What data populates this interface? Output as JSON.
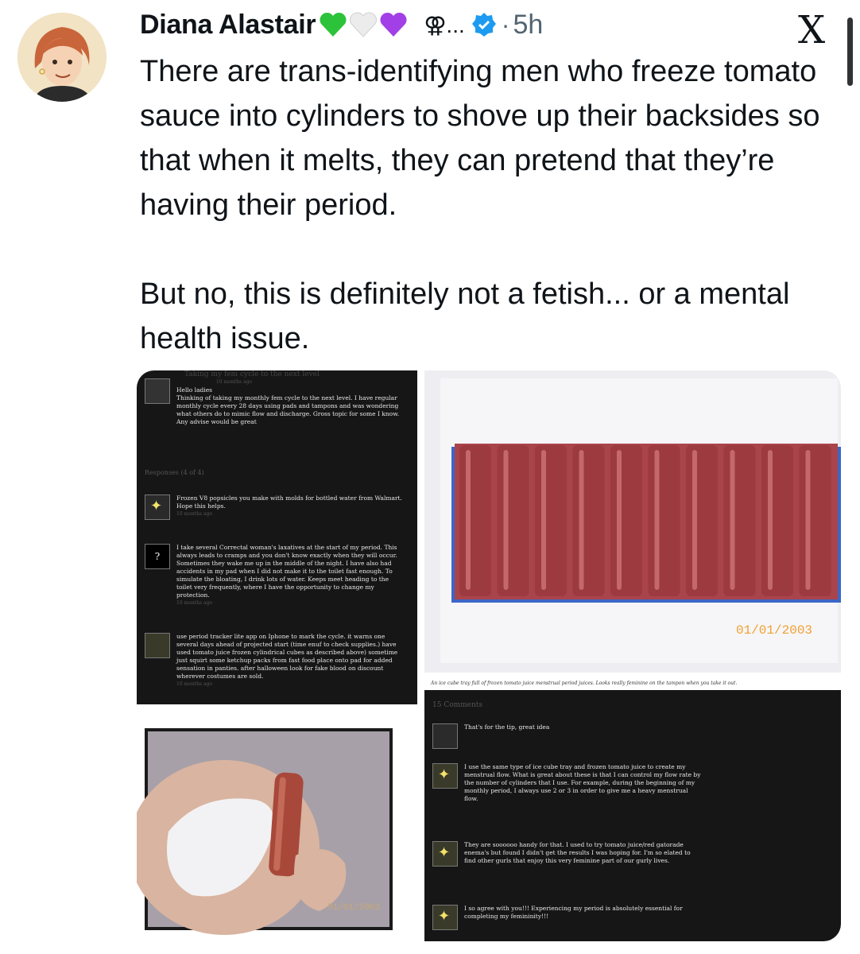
{
  "tweet": {
    "author": "Diana Alastair",
    "emoji_suffix": "⚢...",
    "time": "5h",
    "separator": "·",
    "x_logo": "X",
    "text": "There are trans-identifying men who freeze tomato sauce into cylinders to shove up their backsides so that when it melts, they can pretend that they’re having their period.\n\nBut no, this is definitely not a fetish... or a mental health issue.",
    "icons": [
      "avatar",
      "green-heart-icon",
      "white-heart-icon",
      "purple-heart-icon",
      "verified-badge-icon",
      "x-logo-icon"
    ],
    "colors": {
      "green_heart": "#2cc33a",
      "white_heart": "#e8e8e8",
      "purple_heart": "#a23fe6",
      "verified": "#1d9bf0"
    }
  },
  "forum_left": {
    "title": "Taking my fem cycle to the next level",
    "op_meta": "10 months ago",
    "op_text": "Hello ladies\nThinking of taking my monthly fem cycle to the next level. I have regular monthly cycle every 28 days using pads and tampons and was wondering what others do to mimic flow and discharge. Gross topic for some I know.\nAny advise would be great",
    "responses_label": "Responses (4 of 4)",
    "replies": [
      {
        "text": "Frozen V8 popsicles you make with molds for bottled water from Walmart. Hope this helps.",
        "meta": "10 months ago"
      },
      {
        "text": "I take several Correctal woman's laxatives at the start of my period. This always leads to cramps and you don't know exactly when they will occur. Sometimes they wake me up in the middle of the night. I have also had accidents in my pad when I did not make it to the toilet fast enough. To simulate the bloating, I drink lots of water. Keeps meet heading to the toilet very frequently, where I have the opportunity to change my protection.",
        "meta": "10 months ago"
      },
      {
        "text": "use period tracker lite app on Iphone to mark the cycle. it warns one several days ahead of projected start (time enuf to check supplies.) have used tomato juice frozen cylindrical cubes as described above) sometime just squirt some ketchup packs from fast food place onto pad for added sensation in panties. after halloween look for fake blood on discount wherever costumes are sold.",
        "meta": "10 months ago"
      }
    ]
  },
  "photo_small": {
    "date_stamp": "01/01/2003"
  },
  "photo_tray": {
    "date_stamp": "01/01/2003",
    "caption": "An ice cube tray full of frozen tomato juice menstrual period juices. Looks really feminine on the tampon when you take it out.",
    "comments_label": "15 Comments"
  },
  "forum_right": {
    "comments": [
      {
        "text": "That's for the tip, great idea"
      },
      {
        "text": "I use the same type of ice cube tray and frozen tomato juice to create my menstrual flow. What is great about these is that I can control my flow rate by the number of cylinders that I use. For example, during the beginning of my monthly period, I always use 2 or 3 in order to give me a heavy menstrual flow."
      },
      {
        "text": "They are soooooo handy for that. I used to try tomato juice/red gatorade enema's but found I didn't get the results I was hoping for. I'm so elated to find other gurls that enjoy this very feminine part of our gurly lives."
      },
      {
        "text": "I so agree with you!!! Experiencing my period is absolutely essential for completing my femininity!!!"
      }
    ]
  }
}
